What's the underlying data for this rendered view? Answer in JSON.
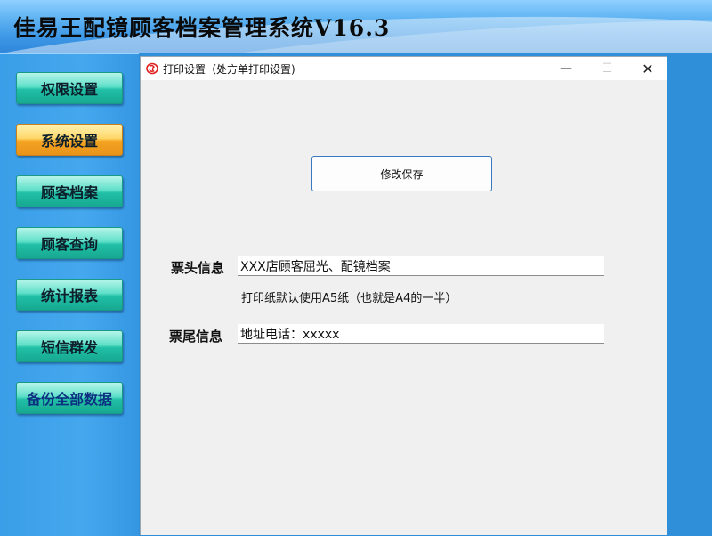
{
  "app": {
    "title": "佳易王配镜顾客档案管理系统V16.3"
  },
  "sidebar": {
    "items": [
      {
        "label": "权限设置",
        "active": false
      },
      {
        "label": "系统设置",
        "active": true
      },
      {
        "label": "顾客档案",
        "active": false
      },
      {
        "label": "顾客查询",
        "active": false
      },
      {
        "label": "统计报表",
        "active": false
      },
      {
        "label": "短信群发",
        "active": false
      },
      {
        "label": "备份全部数据",
        "active": false
      }
    ]
  },
  "dialog": {
    "title": "打印设置（处方单打印设置)",
    "controls": {
      "minimize": "—",
      "maximize": "☐",
      "close": "✕"
    },
    "save_label": "修改保存",
    "header_label": "票头信息",
    "header_value": "XXX店顾客屈光、配镜档案",
    "hint": "打印纸默认使用A5纸（也就是A4的一半）",
    "footer_label": "票尾信息",
    "footer_value": "地址电话：xxxxx"
  },
  "colors": {
    "nav_default": "#21bfa6",
    "nav_active": "#f4a322",
    "save_border": "#3a78c0",
    "logo_red": "#e02020"
  }
}
